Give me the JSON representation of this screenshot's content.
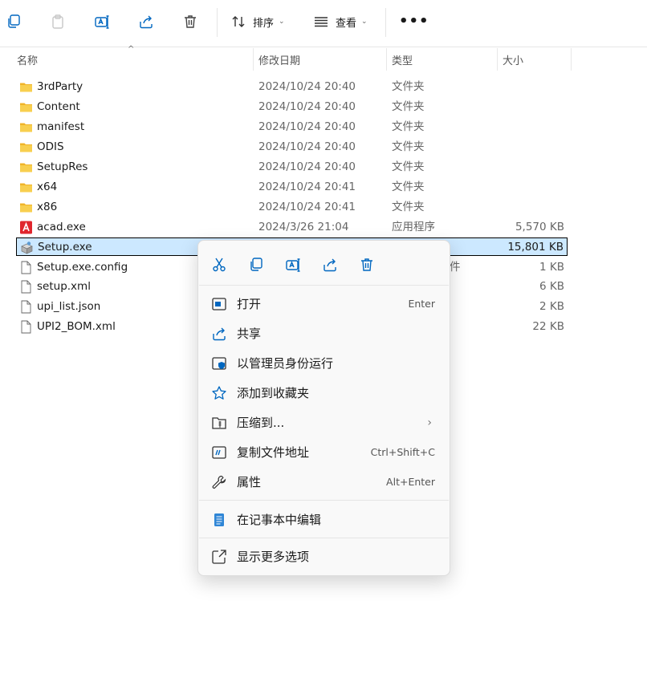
{
  "toolbar": {
    "sort_label": "排序",
    "view_label": "查看",
    "more_label": "•••"
  },
  "columns": {
    "name": "名称",
    "date": "修改日期",
    "type": "类型",
    "size": "大小"
  },
  "files": [
    {
      "name": "3rdParty",
      "date": "2024/10/24 20:40",
      "type": "文件夹",
      "size": "",
      "icon": "folder-icon"
    },
    {
      "name": "Content",
      "date": "2024/10/24 20:40",
      "type": "文件夹",
      "size": "",
      "icon": "folder-icon"
    },
    {
      "name": "manifest",
      "date": "2024/10/24 20:40",
      "type": "文件夹",
      "size": "",
      "icon": "folder-icon"
    },
    {
      "name": "ODIS",
      "date": "2024/10/24 20:40",
      "type": "文件夹",
      "size": "",
      "icon": "folder-icon"
    },
    {
      "name": "SetupRes",
      "date": "2024/10/24 20:40",
      "type": "文件夹",
      "size": "",
      "icon": "folder-icon"
    },
    {
      "name": "x64",
      "date": "2024/10/24 20:41",
      "type": "文件夹",
      "size": "",
      "icon": "folder-icon"
    },
    {
      "name": "x86",
      "date": "2024/10/24 20:41",
      "type": "文件夹",
      "size": "",
      "icon": "folder-icon"
    },
    {
      "name": "acad.exe",
      "date": "2024/3/26 21:04",
      "type": "应用程序",
      "size": "5,570 KB",
      "icon": "autocad-app-icon"
    },
    {
      "name": "Setup.exe",
      "date": "",
      "type": "",
      "size": "15,801 KB",
      "icon": "setup-installer-icon"
    },
    {
      "name": "Setup.exe.config",
      "date": "",
      "type": "件",
      "size": "1 KB",
      "icon": "file-icon"
    },
    {
      "name": "setup.xml",
      "date": "",
      "type": "",
      "size": "6 KB",
      "icon": "file-icon"
    },
    {
      "name": "upi_list.json",
      "date": "",
      "type": "",
      "size": "2 KB",
      "icon": "file-icon"
    },
    {
      "name": "UPI2_BOM.xml",
      "date": "",
      "type": "",
      "size": "22 KB",
      "icon": "file-icon"
    }
  ],
  "context_menu": {
    "items": [
      {
        "label": "打开",
        "shortcut": "Enter",
        "icon": "open-window-icon"
      },
      {
        "label": "共享",
        "shortcut": "",
        "icon": "share-icon"
      },
      {
        "label": "以管理员身份运行",
        "shortcut": "",
        "icon": "shield-run-icon"
      },
      {
        "label": "添加到收藏夹",
        "shortcut": "",
        "icon": "star-icon"
      },
      {
        "label": "压缩到...",
        "shortcut": "",
        "icon": "zip-folder-icon",
        "arrow": "›"
      },
      {
        "label": "复制文件地址",
        "shortcut": "Ctrl+Shift+C",
        "icon": "copy-path-icon"
      },
      {
        "label": "属性",
        "shortcut": "Alt+Enter",
        "icon": "wrench-icon"
      },
      {
        "label": "在记事本中编辑",
        "shortcut": "",
        "icon": "notepad-icon"
      },
      {
        "label": "显示更多选项",
        "shortcut": "",
        "icon": "more-options-icon"
      }
    ]
  },
  "colors": {
    "selection_bg": "#cce8ff",
    "folder": "#f5c242",
    "accent": "#0067c0"
  }
}
